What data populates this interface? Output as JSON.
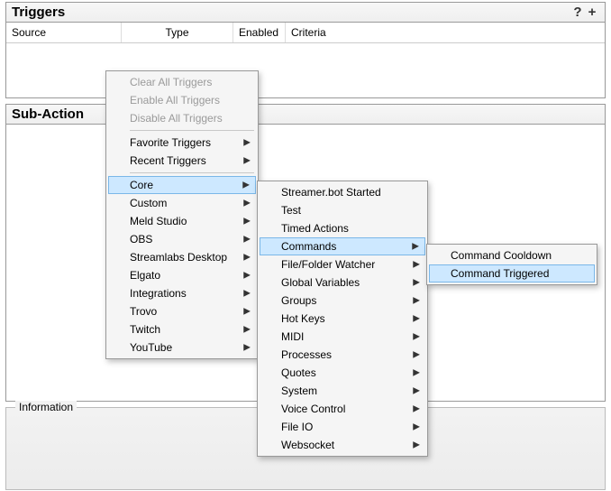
{
  "triggers": {
    "title": "Triggers",
    "help": "?",
    "add": "+",
    "columns": {
      "source": "Source",
      "type": "Type",
      "enabled": "Enabled",
      "criteria": "Criteria"
    }
  },
  "subactions": {
    "title": "Sub-Action"
  },
  "info": {
    "title": "Information"
  },
  "menu1": {
    "clear": "Clear All Triggers",
    "enable": "Enable All Triggers",
    "disable": "Disable All Triggers",
    "favorite": "Favorite Triggers",
    "recent": "Recent Triggers",
    "core": "Core",
    "custom": "Custom",
    "meld": "Meld Studio",
    "obs": "OBS",
    "streamlabs": "Streamlabs Desktop",
    "elgato": "Elgato",
    "integrations": "Integrations",
    "trovo": "Trovo",
    "twitch": "Twitch",
    "youtube": "YouTube"
  },
  "menu2": {
    "started": "Streamer.bot Started",
    "test": "Test",
    "timed": "Timed Actions",
    "commands": "Commands",
    "filefolder": "File/Folder Watcher",
    "globals": "Global Variables",
    "groups": "Groups",
    "hotkeys": "Hot Keys",
    "midi": "MIDI",
    "processes": "Processes",
    "quotes": "Quotes",
    "system": "System",
    "voice": "Voice Control",
    "fileio": "File IO",
    "websocket": "Websocket"
  },
  "menu3": {
    "cooldown": "Command Cooldown",
    "triggered": "Command Triggered"
  }
}
